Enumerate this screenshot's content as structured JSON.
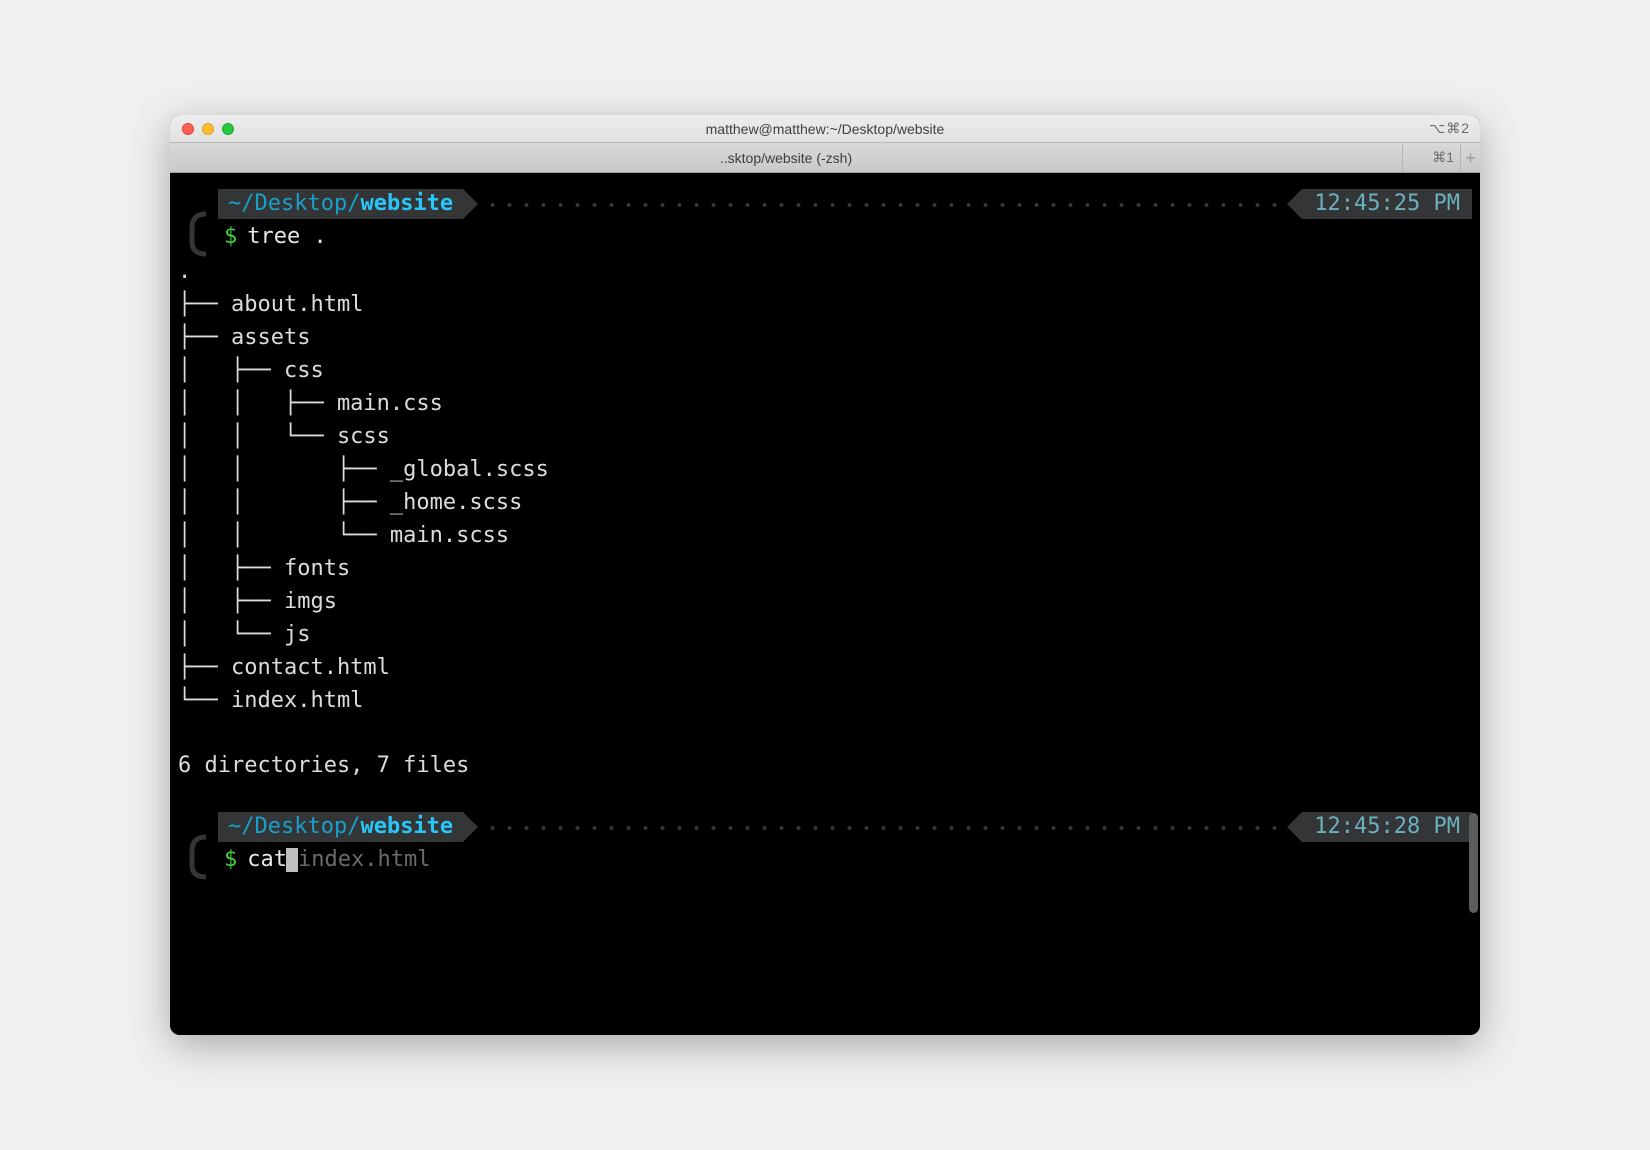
{
  "window": {
    "title": "matthew@matthew:~/Desktop/website",
    "keyhint_right": "⌥⌘2"
  },
  "tab": {
    "label": "..sktop/website (-zsh)",
    "keyhint": "⌘1"
  },
  "prompts": [
    {
      "path_prefix": "~/Desktop/",
      "path_leaf": "website",
      "time": "12:45:25  PM",
      "dollar": "$",
      "command": "tree ."
    },
    {
      "path_prefix": "~/Desktop/",
      "path_leaf": "website",
      "time": "12:45:28  PM",
      "dollar": "$",
      "command_typed": "cat",
      "command_suggest": "index.html"
    }
  ],
  "tree_output": {
    "root": ".",
    "lines": [
      "├── about.html",
      "├── assets",
      "│   ├── css",
      "│   │   ├── main.css",
      "│   │   └── scss",
      "│   │       ├── _global.scss",
      "│   │       ├── _home.scss",
      "│   │       └── main.scss",
      "│   ├── fonts",
      "│   ├── imgs",
      "│   └── js",
      "├── contact.html",
      "└── index.html"
    ],
    "summary": "6 directories, 7 files"
  },
  "colors": {
    "path_dim": "#1a9fc9",
    "path_bold": "#28c7f7",
    "dollar": "#3ed13e",
    "pill_bg": "#333537",
    "time": "#6bb0bf"
  }
}
